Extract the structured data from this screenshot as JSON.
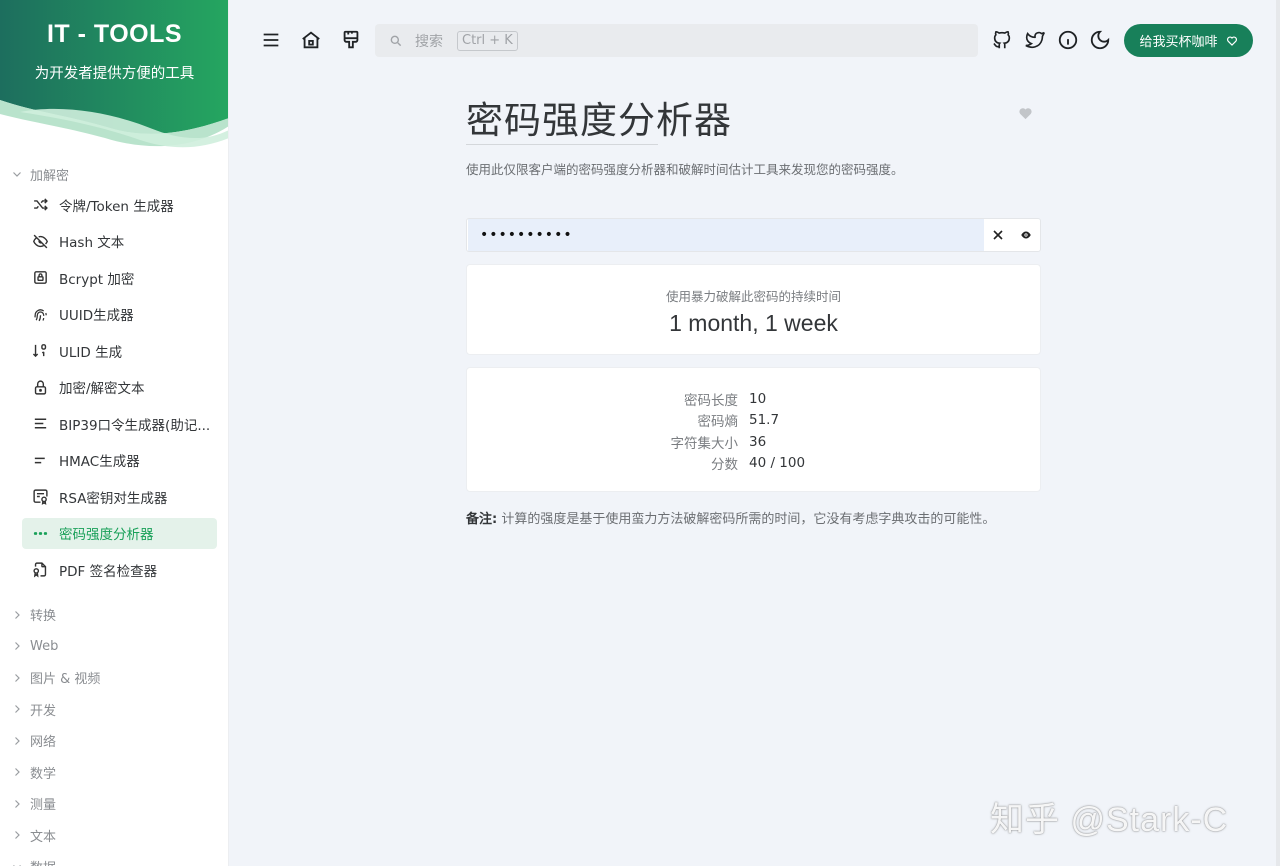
{
  "app": {
    "title": "IT - TOOLS",
    "subtitle": "为开发者提供方便的工具",
    "brand_color": "#18a058"
  },
  "sidebar": {
    "open_group": "加解密",
    "items": [
      {
        "label": "令牌/Token 生成器",
        "icon": "shuffle-icon"
      },
      {
        "label": "Hash 文本",
        "icon": "eye-off-icon"
      },
      {
        "label": "Bcrypt 加密",
        "icon": "lock-square-icon"
      },
      {
        "label": "UUID生成器",
        "icon": "fingerprint-icon"
      },
      {
        "label": "ULID 生成",
        "icon": "sort-numeric-icon"
      },
      {
        "label": "加密/解密文本",
        "icon": "lock-icon"
      },
      {
        "label": "BIP39口令生成器(助记...",
        "icon": "align-left-icon"
      },
      {
        "label": "HMAC生成器",
        "icon": "short-text-icon"
      },
      {
        "label": "RSA密钥对生成器",
        "icon": "certificate-icon"
      },
      {
        "label": "密码强度分析器",
        "icon": "password-icon",
        "active": true
      },
      {
        "label": "PDF 签名检查器",
        "icon": "file-certificate-icon"
      }
    ],
    "groups": [
      "转换",
      "Web",
      "图片 & 视频",
      "开发",
      "网络",
      "数学",
      "测量",
      "文本",
      "数据"
    ]
  },
  "topbar": {
    "search_placeholder": "搜索",
    "search_shortcut": "Ctrl + K",
    "coffee_label": "给我买杯咖啡"
  },
  "main": {
    "title": "密码强度分析器",
    "description": "使用此仅限客户端的密码强度分析器和破解时间估计工具来发现您的密码强度。",
    "password_value": "••••••••••",
    "crack_label": "使用暴力破解此密码的持续时间",
    "crack_value": "1 month, 1 week",
    "stats": [
      {
        "key": "密码长度",
        "value": "10"
      },
      {
        "key": "密码熵",
        "value": "51.7"
      },
      {
        "key": "字符集大小",
        "value": "36"
      },
      {
        "key": "分数",
        "value": "40 / 100"
      }
    ],
    "note_label": "备注:",
    "note_text": " 计算的强度是基于使用蛮力方法破解密码所需的时间，它没有考虑字典攻击的可能性。"
  },
  "watermark": "知乎 @Stark-C"
}
